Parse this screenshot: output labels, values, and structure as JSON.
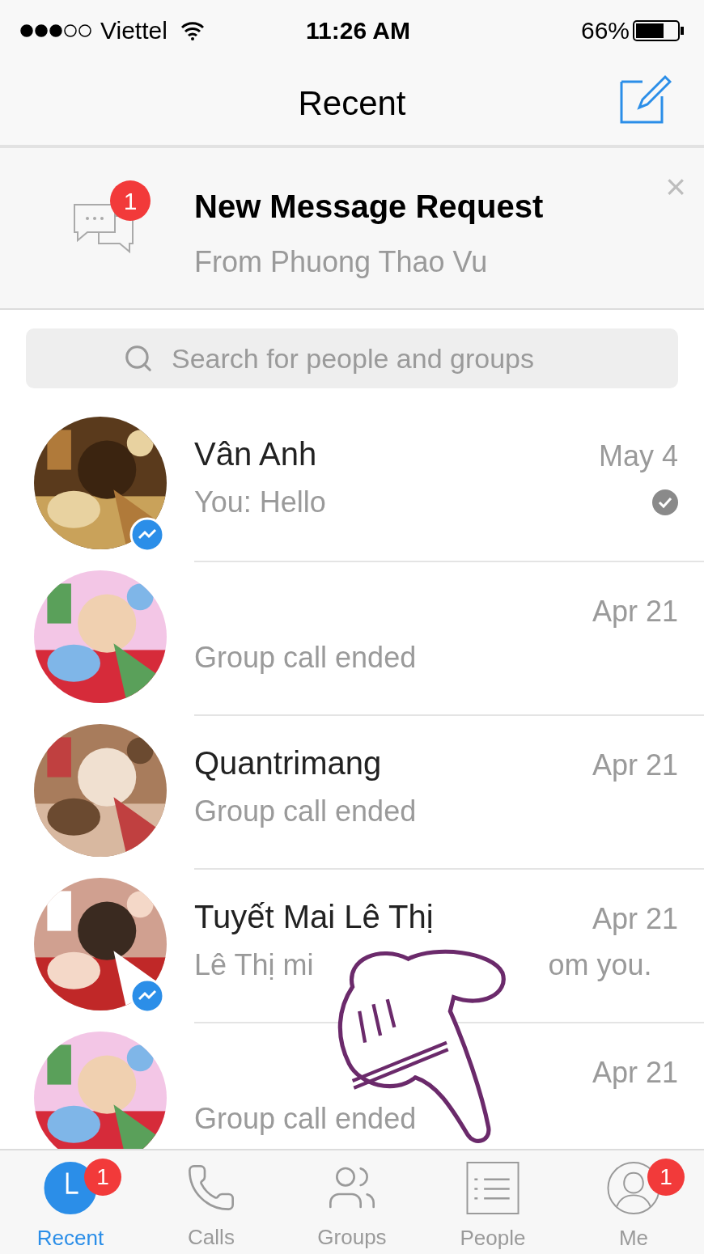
{
  "status_bar": {
    "carrier": "Viettel",
    "time": "11:26 AM",
    "battery": "66%"
  },
  "nav": {
    "title": "Recent"
  },
  "request_banner": {
    "title": "New Message Request",
    "subtitle": "From Phuong Thao Vu",
    "badge": "1",
    "close": "×"
  },
  "search": {
    "placeholder": "Search for people and groups"
  },
  "conversations": [
    {
      "name": "Vân Anh",
      "preview": [
        "You: Hello"
      ],
      "time": "May 4",
      "messenger_badge": true,
      "seen": true
    },
    {
      "preview": [
        "Group call ended"
      ],
      "time": "Apr 21",
      "messenger_badge": false,
      "seen": false
    },
    {
      "name": "Quantrimang",
      "preview": [
        "Group call ended"
      ],
      "time": "Apr 21",
      "messenger_badge": false,
      "seen": false
    },
    {
      "name": "Tuyết Mai Lê Thị",
      "preview": [
        "Lê Thị mi",
        "om you."
      ],
      "time": "Apr 21",
      "messenger_badge": true,
      "seen": false
    },
    {
      "preview": [
        "Group call ended"
      ],
      "time": "Apr 21",
      "messenger_badge": false,
      "seen": false
    }
  ],
  "tab_bar": [
    {
      "kind": "recent",
      "label": "Recent",
      "selected": true,
      "badge": "1"
    },
    {
      "kind": "calls",
      "label": "Calls",
      "selected": false
    },
    {
      "kind": "groups",
      "label": "Groups",
      "selected": false
    },
    {
      "kind": "people",
      "label": "People",
      "selected": false
    },
    {
      "kind": "me",
      "label": "Me",
      "selected": false,
      "badge": "1"
    }
  ]
}
